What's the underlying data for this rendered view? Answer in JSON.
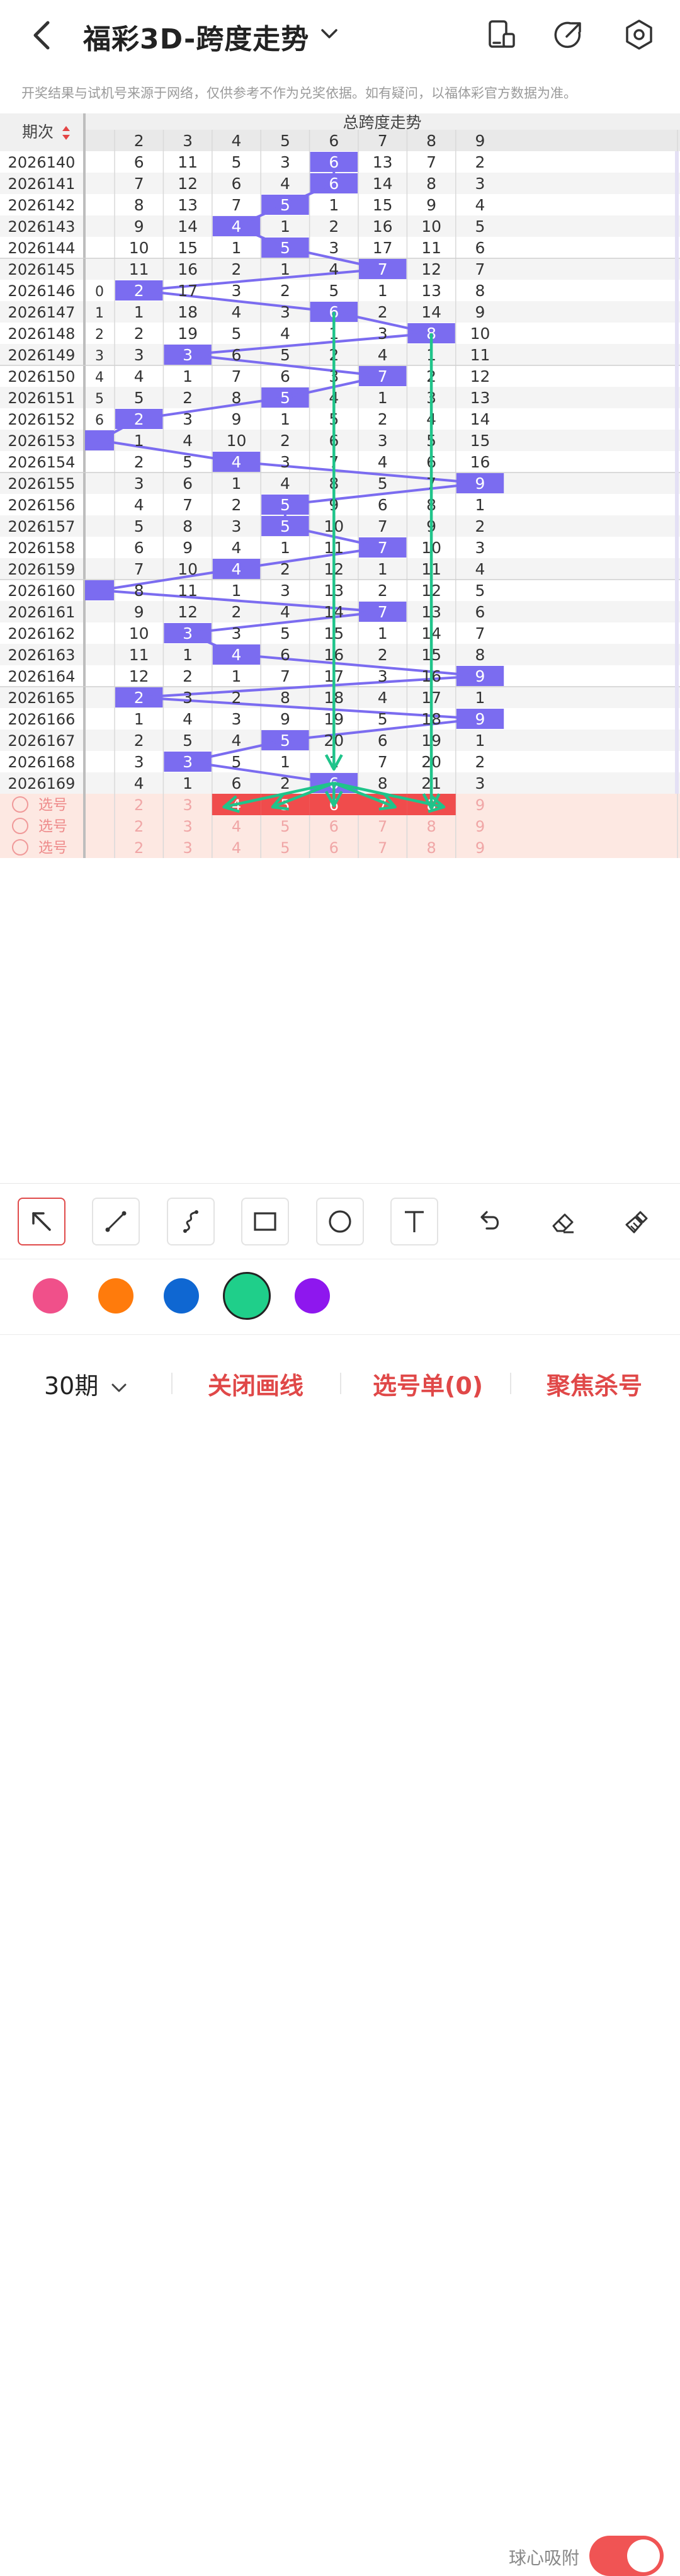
{
  "header": {
    "title": "福彩3D-跨度走势",
    "disclaimer": "开奖结果与试机号来源于网络，仅供参考不作为兑奖依据。如有疑问，以福体彩官方数据为准。"
  },
  "table": {
    "period_header": "期次",
    "group_header": "总跨度走势",
    "columns": [
      "",
      "2",
      "3",
      "4",
      "5",
      "6",
      "7",
      "8",
      "9"
    ],
    "rows": [
      {
        "period": "2026140",
        "cells": [
          "",
          "6",
          "11",
          "5",
          "3",
          "6",
          "13",
          "7",
          "2"
        ],
        "hit": 5
      },
      {
        "period": "2026141",
        "cells": [
          "",
          "7",
          "12",
          "6",
          "4",
          "6",
          "14",
          "8",
          "3"
        ],
        "hit": 5
      },
      {
        "period": "2026142",
        "cells": [
          "",
          "8",
          "13",
          "7",
          "5",
          "1",
          "15",
          "9",
          "4"
        ],
        "hit": 4
      },
      {
        "period": "2026143",
        "cells": [
          "",
          "9",
          "14",
          "4",
          "1",
          "2",
          "16",
          "10",
          "5"
        ],
        "hit": 3
      },
      {
        "period": "2026144",
        "cells": [
          "",
          "10",
          "15",
          "1",
          "5",
          "3",
          "17",
          "11",
          "6"
        ],
        "hit": 4
      },
      {
        "period": "2026145",
        "cells": [
          "",
          "11",
          "16",
          "2",
          "1",
          "4",
          "7",
          "12",
          "7"
        ],
        "hit": 6
      },
      {
        "period": "2026146",
        "cells": [
          "0",
          "2",
          "17",
          "3",
          "2",
          "5",
          "1",
          "13",
          "8"
        ],
        "hit": 1
      },
      {
        "period": "2026147",
        "cells": [
          "1",
          "1",
          "18",
          "4",
          "3",
          "6",
          "2",
          "14",
          "9"
        ],
        "hit": 5
      },
      {
        "period": "2026148",
        "cells": [
          "2",
          "2",
          "19",
          "5",
          "4",
          "1",
          "3",
          "8",
          "10"
        ],
        "hit": 7
      },
      {
        "period": "2026149",
        "cells": [
          "3",
          "3",
          "3",
          "6",
          "5",
          "2",
          "4",
          "1",
          "11"
        ],
        "hit": 2
      },
      {
        "period": "2026150",
        "cells": [
          "4",
          "4",
          "1",
          "7",
          "6",
          "3",
          "7",
          "2",
          "12"
        ],
        "hit": 6
      },
      {
        "period": "2026151",
        "cells": [
          "5",
          "5",
          "2",
          "8",
          "5",
          "4",
          "1",
          "3",
          "13"
        ],
        "hit": 4
      },
      {
        "period": "2026152",
        "cells": [
          "6",
          "2",
          "3",
          "9",
          "1",
          "5",
          "2",
          "4",
          "14"
        ],
        "hit": 1
      },
      {
        "period": "2026153",
        "cells": [
          "",
          "1",
          "4",
          "10",
          "2",
          "6",
          "3",
          "5",
          "15"
        ],
        "hit": 0
      },
      {
        "period": "2026154",
        "cells": [
          "",
          "2",
          "5",
          "4",
          "3",
          "7",
          "4",
          "6",
          "16"
        ],
        "hit": 3
      },
      {
        "period": "2026155",
        "cells": [
          "",
          "3",
          "6",
          "1",
          "4",
          "8",
          "5",
          "7",
          "9"
        ],
        "hit": 8
      },
      {
        "period": "2026156",
        "cells": [
          "",
          "4",
          "7",
          "2",
          "5",
          "9",
          "6",
          "8",
          "1"
        ],
        "hit": 4
      },
      {
        "period": "2026157",
        "cells": [
          "",
          "5",
          "8",
          "3",
          "5",
          "10",
          "7",
          "9",
          "2"
        ],
        "hit": 4
      },
      {
        "period": "2026158",
        "cells": [
          "",
          "6",
          "9",
          "4",
          "1",
          "11",
          "7",
          "10",
          "3"
        ],
        "hit": 6
      },
      {
        "period": "2026159",
        "cells": [
          "",
          "7",
          "10",
          "4",
          "2",
          "12",
          "1",
          "11",
          "4"
        ],
        "hit": 3
      },
      {
        "period": "2026160",
        "cells": [
          "",
          "8",
          "11",
          "1",
          "3",
          "13",
          "2",
          "12",
          "5"
        ],
        "hit": 0
      },
      {
        "period": "2026161",
        "cells": [
          "",
          "9",
          "12",
          "2",
          "4",
          "14",
          "7",
          "13",
          "6"
        ],
        "hit": 6
      },
      {
        "period": "2026162",
        "cells": [
          "",
          "10",
          "3",
          "3",
          "5",
          "15",
          "1",
          "14",
          "7"
        ],
        "hit": 2
      },
      {
        "period": "2026163",
        "cells": [
          "",
          "11",
          "1",
          "4",
          "6",
          "16",
          "2",
          "15",
          "8"
        ],
        "hit": 3
      },
      {
        "period": "2026164",
        "cells": [
          "",
          "12",
          "2",
          "1",
          "7",
          "17",
          "3",
          "16",
          "9"
        ],
        "hit": 8
      },
      {
        "period": "2026165",
        "cells": [
          "",
          "2",
          "3",
          "2",
          "8",
          "18",
          "4",
          "17",
          "1"
        ],
        "hit": 1
      },
      {
        "period": "2026166",
        "cells": [
          "",
          "1",
          "4",
          "3",
          "9",
          "19",
          "5",
          "18",
          "9"
        ],
        "hit": 8
      },
      {
        "period": "2026167",
        "cells": [
          "",
          "2",
          "5",
          "4",
          "5",
          "20",
          "6",
          "19",
          "1"
        ],
        "hit": 4
      },
      {
        "period": "2026168",
        "cells": [
          "",
          "3",
          "3",
          "5",
          "1",
          "1",
          "7",
          "20",
          "2"
        ],
        "hit": 2
      },
      {
        "period": "2026169",
        "cells": [
          "",
          "4",
          "1",
          "6",
          "2",
          "6",
          "8",
          "21",
          "3"
        ],
        "hit": 5
      }
    ],
    "select_label": "选号",
    "select_rows": [
      {
        "cells": [
          "",
          "2",
          "3",
          "4",
          "5",
          "6",
          "7",
          "8",
          "9"
        ],
        "highlight": [
          3,
          4,
          5,
          6,
          7
        ]
      },
      {
        "cells": [
          "",
          "2",
          "3",
          "4",
          "5",
          "6",
          "7",
          "8",
          "9"
        ],
        "highlight": []
      },
      {
        "cells": [
          "",
          "2",
          "3",
          "4",
          "5",
          "6",
          "7",
          "8",
          "9"
        ],
        "highlight": []
      }
    ]
  },
  "toolbar": {
    "tools": [
      "arrow-tool-icon",
      "line-tool-icon",
      "curve-tool-icon",
      "rectangle-tool-icon",
      "circle-tool-icon",
      "text-tool-icon",
      "undo-icon",
      "eraser-icon",
      "clear-icon"
    ],
    "active": 0
  },
  "colors": {
    "swatches": [
      "#f0508a",
      "#ff7b0c",
      "#0f67d2",
      "#1fcf8a",
      "#8e17ee"
    ],
    "selected": 3,
    "hit": "#7b6cf0",
    "trend_line": "#7b6cf0",
    "drawn_line": "#1fc48a",
    "select_hit": "#f04c4c",
    "select_bg": "#fde8e2"
  },
  "snap": {
    "label": "球心吸附",
    "on": true
  },
  "bottom": {
    "period": "30期",
    "close_draw": "关闭画线",
    "pick_list": "选号单(0)",
    "focus_kill": "聚焦杀号"
  }
}
